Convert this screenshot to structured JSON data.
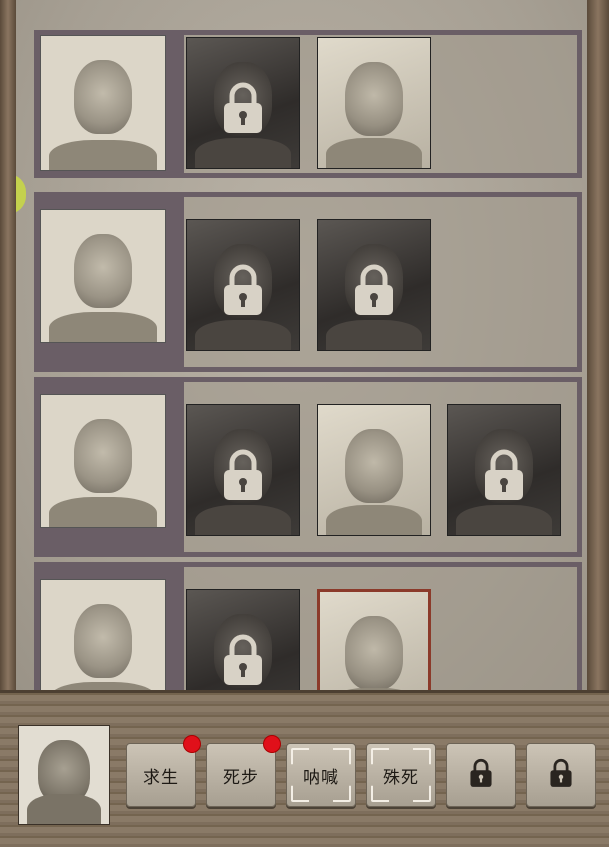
{
  "rows": [
    {
      "cards": [
        {
          "name": "row1-main-portrait",
          "state": "open"
        },
        {
          "name": "row1-skin-2",
          "state": "locked"
        },
        {
          "name": "row1-skin-3",
          "state": "open"
        }
      ]
    },
    {
      "cards": [
        {
          "name": "row2-main-portrait",
          "state": "open"
        },
        {
          "name": "row2-skin-2",
          "state": "locked"
        },
        {
          "name": "row2-skin-3",
          "state": "locked"
        }
      ]
    },
    {
      "cards": [
        {
          "name": "row3-main-portrait",
          "state": "open"
        },
        {
          "name": "row3-skin-2",
          "state": "locked"
        },
        {
          "name": "row3-skin-3",
          "state": "open"
        },
        {
          "name": "row3-skin-4",
          "state": "locked"
        }
      ]
    },
    {
      "cards": [
        {
          "name": "row4-main-portrait",
          "state": "open"
        },
        {
          "name": "row4-skin-2",
          "state": "locked"
        },
        {
          "name": "row4-skin-3",
          "state": "selected"
        }
      ]
    }
  ],
  "bottom_bar": {
    "skills": [
      {
        "label": "求生",
        "badge": true,
        "framed": false
      },
      {
        "label": "死步",
        "badge": true,
        "framed": false
      },
      {
        "label": "呐喊",
        "badge": false,
        "framed": true
      },
      {
        "label": "殊死",
        "badge": false,
        "framed": true
      },
      {
        "label": "",
        "locked": true
      },
      {
        "label": "",
        "locked": true
      }
    ]
  },
  "colors": {
    "badge": "#e0101a",
    "selected_border": "#8b3a2a",
    "row_frame": "#6a5e66"
  }
}
